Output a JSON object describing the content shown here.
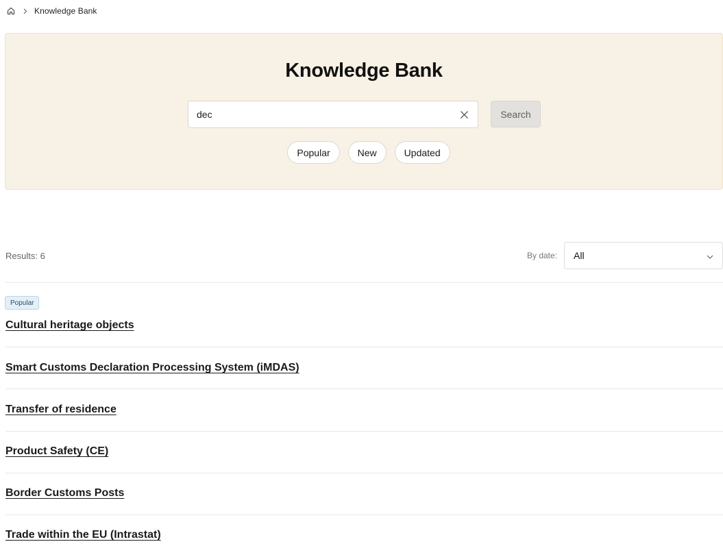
{
  "breadcrumb": {
    "home_icon": "home-icon",
    "separator_icon": "chevron-right-icon",
    "current": "Knowledge Bank"
  },
  "hero": {
    "title": "Knowledge Bank",
    "search": {
      "value": "dec",
      "placeholder": "",
      "clear_icon": "close-icon"
    },
    "search_button_label": "Search",
    "filters": [
      {
        "label": "Popular"
      },
      {
        "label": "New"
      },
      {
        "label": "Updated"
      }
    ]
  },
  "results_bar": {
    "count_label": "Results: 6",
    "date_filter_label": "By date:",
    "date_filter_selected": "All",
    "dropdown_icon": "chevron-down-icon"
  },
  "results": [
    {
      "badge": "Popular",
      "title": "Cultural heritage objects"
    },
    {
      "title": "Smart Customs Declaration Processing System (iMDAS)"
    },
    {
      "title": "Transfer of residence"
    },
    {
      "title": "Product Safety (CE)"
    },
    {
      "title": "Border Customs Posts"
    },
    {
      "title": "Trade within the EU (Intrastat)"
    }
  ],
  "colors": {
    "hero_background": "#f8f1e5",
    "badge_background": "#e4f0f8",
    "search_button_background": "#e3e1de"
  }
}
